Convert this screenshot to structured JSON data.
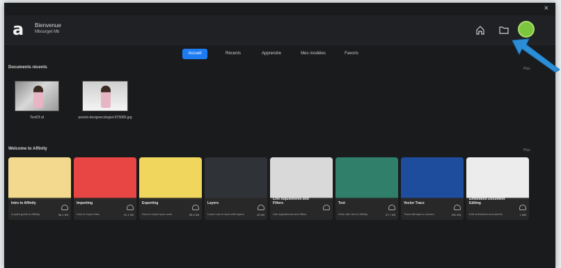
{
  "header": {
    "logo": "a",
    "welcome_line1": "Bienvenue",
    "welcome_line2": "Mbourget Mb",
    "close": "×"
  },
  "tabs": [
    {
      "label": "Accueil",
      "active": true
    },
    {
      "label": "Récents"
    },
    {
      "label": "Apprendre"
    },
    {
      "label": "Mes modèles"
    },
    {
      "label": "Favoris"
    }
  ],
  "recent_docs": {
    "title": "Documents récents",
    "more": "Plus",
    "items": [
      {
        "name": "TestOf.af"
      },
      {
        "name": "pexels-designecologist-975685.jpg"
      }
    ]
  },
  "welcome": {
    "title": "Welcome to Affinity",
    "more": "Plus",
    "cards": [
      {
        "title": "Intro to Affinity",
        "subtitle": "A quick guide to Affinity",
        "size": "96.1 KB"
      },
      {
        "title": "Importing",
        "subtitle": "How to import files",
        "size": "31.1 KB"
      },
      {
        "title": "Exporting",
        "subtitle": "How to export your work",
        "size": "55.4 KB"
      },
      {
        "title": "Layers",
        "subtitle": "Learn how to work with layers",
        "size": "40 KB"
      },
      {
        "title": "Live Adjustments and Filters",
        "subtitle": "Use adjustments and filters",
        "size": ""
      },
      {
        "title": "Text",
        "subtitle": "Work with text in Affinity",
        "size": "37.7 KB"
      },
      {
        "title": "Vector Trace",
        "subtitle": "Trace bitmaps to vectors",
        "size": "200 KB"
      },
      {
        "title": "Embedded Document Editing",
        "subtitle": "Edit embedded documents",
        "size": "1 MB"
      }
    ]
  },
  "colors": {
    "accent": "#1d7cf2",
    "background": "#1a1b1d",
    "avatar": "#7cc63f",
    "arrow": "#2d8ed8"
  }
}
